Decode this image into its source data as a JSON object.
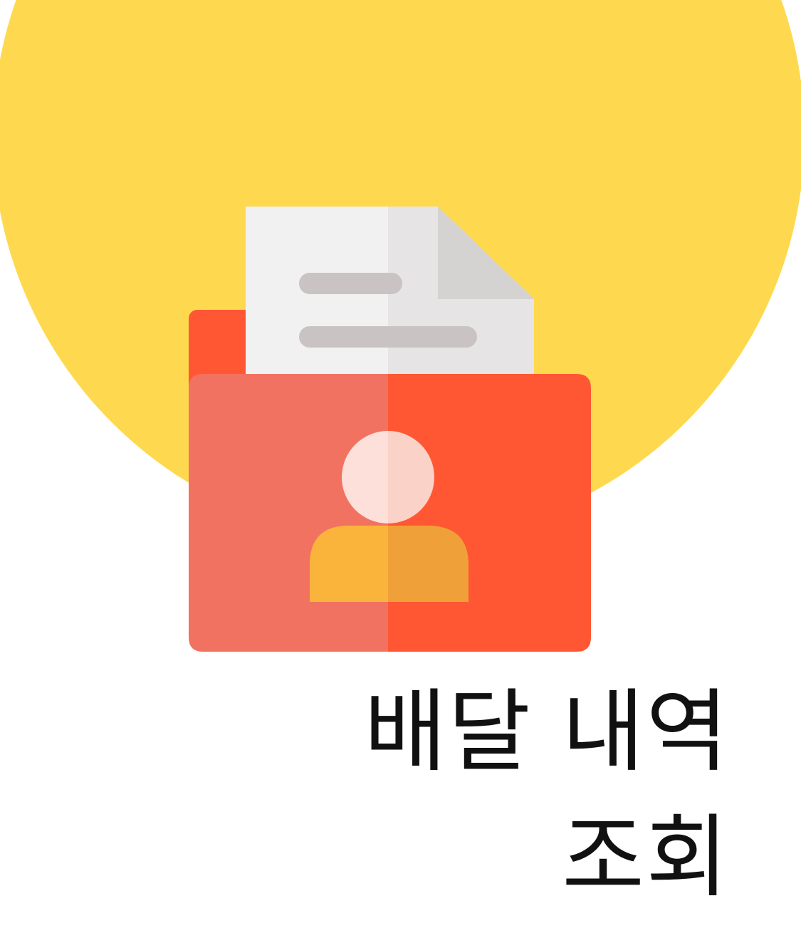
{
  "menu_item": {
    "label_line1": "배달 내역",
    "label_line2": "조회",
    "icon": "delivery-history-folder-icon"
  },
  "colors": {
    "circle": "#FED94F",
    "folder_left": "#F27262",
    "folder_right": "#FF5733",
    "tab": "#FF5733",
    "paper_left": "#F2F1F1",
    "paper_right": "#E6E4E4",
    "paper_fold": "#D5D2D2",
    "paper_lines": "#C9C3C3",
    "person_head_left": "#FCE0D9",
    "person_head_right": "#FBD2C7",
    "person_body_left": "#FBB43B",
    "person_body_right": "#EFA038",
    "text": "#111111"
  }
}
